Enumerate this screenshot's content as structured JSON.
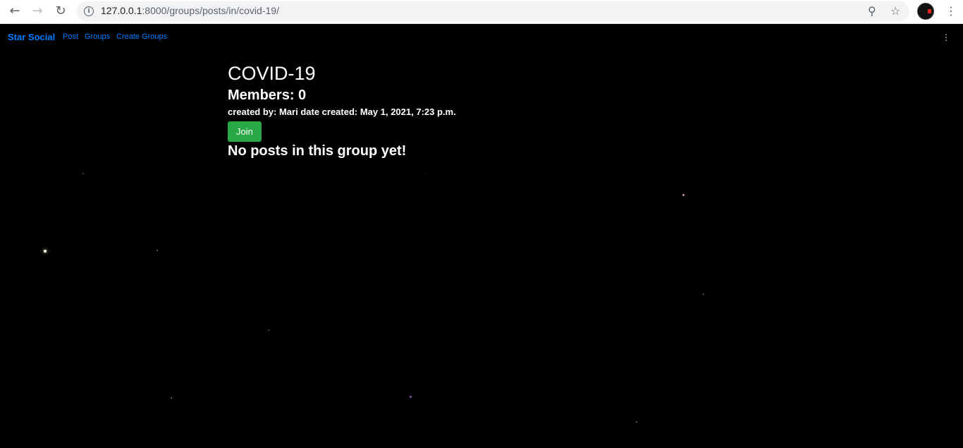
{
  "browser": {
    "url_host": "127.0.0.1",
    "url_path": ":8000/groups/posts/in/covid-19/"
  },
  "navbar": {
    "brand": "Star Social",
    "links": [
      "Post",
      "Groups",
      "Create Groups"
    ]
  },
  "group": {
    "title": "COVID-19",
    "members": "Members: 0",
    "meta": "created by: Mari date created: May 1, 2021, 7:23 p.m.",
    "join_label": "Join",
    "empty_message": "No posts in this group yet!"
  },
  "colors": {
    "accent": "#007bff",
    "join": "#28a745",
    "background": "#000000"
  }
}
